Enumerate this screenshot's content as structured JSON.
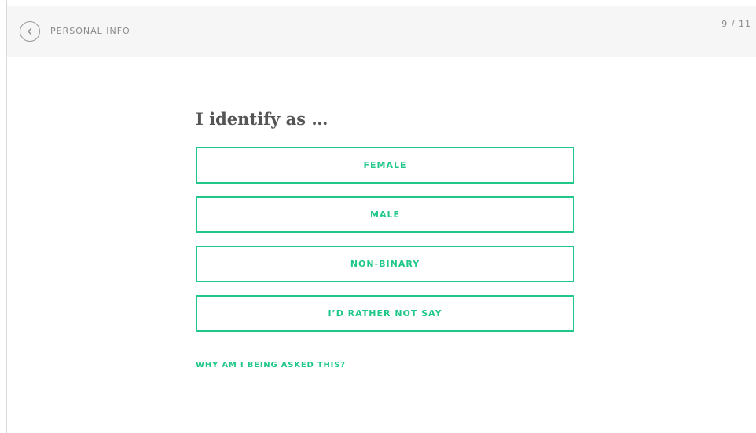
{
  "header": {
    "back_icon": "chevron-left-icon",
    "title": "PERSONAL INFO",
    "step_counter": "9 / 11"
  },
  "question": {
    "title": "I identify as …",
    "options": [
      {
        "label": "FEMALE"
      },
      {
        "label": "MALE"
      },
      {
        "label": "NON-BINARY"
      },
      {
        "label": "I’D RATHER NOT SAY"
      }
    ]
  },
  "help_link": {
    "label": "WHY AM I BEING ASKED THIS?"
  },
  "colors": {
    "accent": "#1fc788",
    "header_bg": "#f6f6f6",
    "muted_text": "#8a8a8a",
    "heading_text": "#555555"
  }
}
